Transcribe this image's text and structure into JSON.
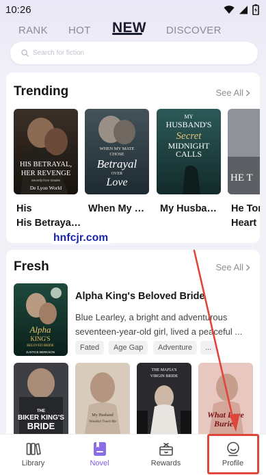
{
  "status_bar": {
    "time": "10:26",
    "icons": [
      "wifi-icon",
      "signal-icon",
      "battery-icon"
    ]
  },
  "top_tabs": [
    {
      "label": "RANK",
      "active": false
    },
    {
      "label": "HOT",
      "active": false
    },
    {
      "label": "NEW",
      "active": true
    },
    {
      "label": "DISCOVER",
      "active": false
    }
  ],
  "search": {
    "placeholder": "Search for fiction",
    "icon": "search-icon"
  },
  "trending": {
    "title": "Trending",
    "see_all": "See All",
    "books": [
      {
        "title": "His Betrayal, ...",
        "cover_text": [
          "HIS BETRAYAL,",
          "HER REVENGE",
          "Secretly from Grades",
          "De Lyon World"
        ]
      },
      {
        "title": "When My Mate Cho...",
        "cover_text": [
          "WHEN MY MATE",
          "CHOSE",
          "Betrayal",
          "OVER",
          "Love"
        ]
      },
      {
        "title": "My Husband's...",
        "cover_text": [
          "MY",
          "HUSBAND'S",
          "Secret",
          "MIDNIGHT",
          "CALLS"
        ]
      },
      {
        "title": "He Tor...",
        "cover_text": [
          "HE T"
        ]
      }
    ],
    "book_titles_line2_trail": "Heart"
  },
  "fresh": {
    "title": "Fresh",
    "see_all": "See All",
    "featured": {
      "title": "Alpha King's Beloved Bride",
      "description_line1": "Blue Learley, a bright and adventurous",
      "description_line2": "seventeen-year-old girl, lived a peaceful ...",
      "tags": [
        "Fated",
        "Age Gap",
        "Adventure",
        "..."
      ],
      "cover_text": [
        "Alpha",
        "KING'S",
        "BELOVED BRIDE",
        "JUSTICE BERKSON"
      ]
    },
    "books": [
      {
        "cover_text": [
          "THE",
          "BIKER KING'S",
          "BRIDE"
        ]
      },
      {
        "cover_text": [
          "My Husband",
          "Wouldn't Touch Me"
        ]
      },
      {
        "cover_text": [
          "THE MAFIA'S",
          "VIRGIN BRIDE"
        ]
      },
      {
        "cover_text": [
          "What Love",
          "Buried"
        ]
      }
    ]
  },
  "watermark": "hnfcjr.com",
  "bottom_nav": [
    {
      "label": "Library",
      "icon": "library-icon",
      "active": false
    },
    {
      "label": "Novel",
      "icon": "novel-icon",
      "active": true
    },
    {
      "label": "Rewards",
      "icon": "rewards-icon",
      "active": false
    },
    {
      "label": "Profile",
      "icon": "profile-icon",
      "active": false
    }
  ],
  "colors": {
    "accent": "#7d5fe0",
    "annotation": "#e0453a",
    "watermark": "#1522a8"
  }
}
